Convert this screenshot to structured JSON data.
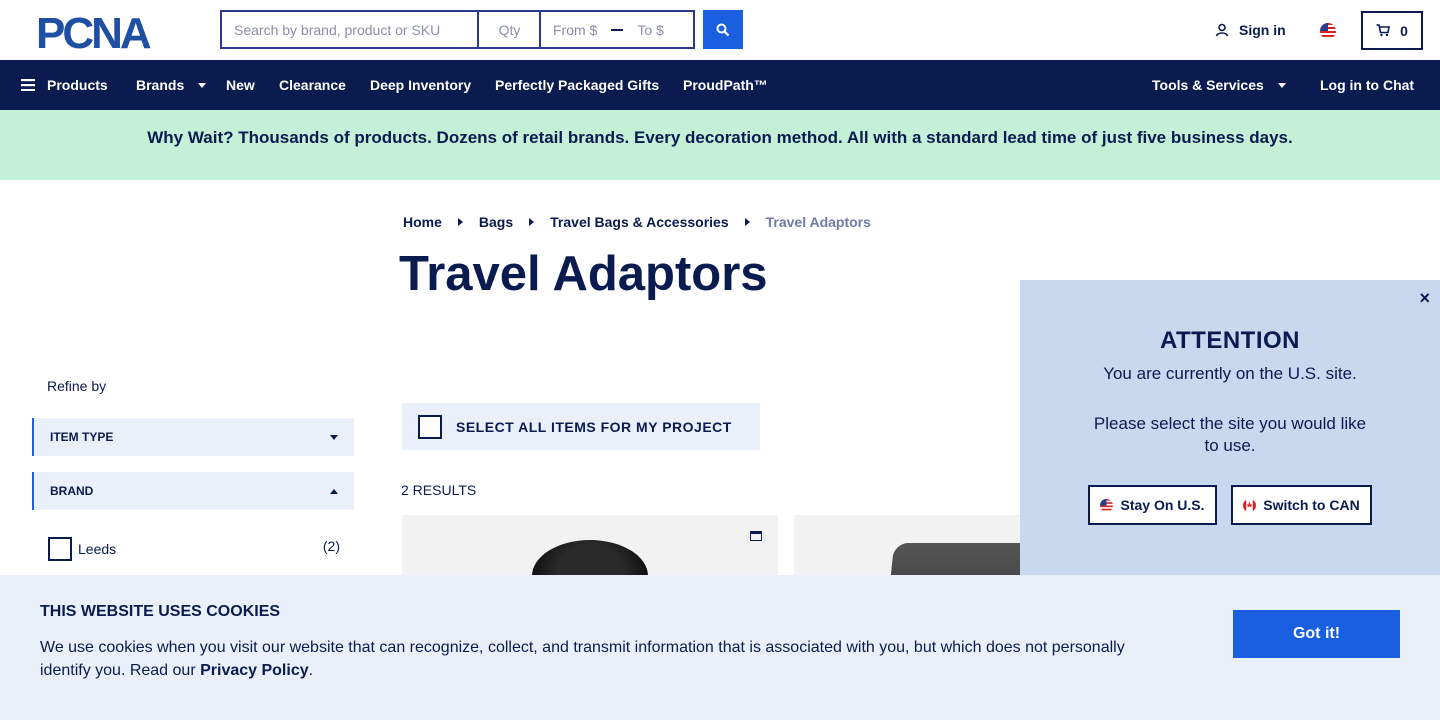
{
  "header": {
    "logo_text": "PCNA",
    "search_placeholder": "Search by brand, product or SKU",
    "qty_placeholder": "Qty",
    "price_from_placeholder": "From $",
    "price_to_placeholder": "To $",
    "signin_label": "Sign in",
    "cart_count": "0",
    "search_icon": "search-icon",
    "user_icon": "user-icon",
    "cart_icon": "cart-icon",
    "flag_icon": "us-flag-icon"
  },
  "nav": {
    "products": "Products",
    "brands": "Brands",
    "new": "New",
    "clearance": "Clearance",
    "deep_inventory": "Deep Inventory",
    "gifts": "Perfectly Packaged Gifts",
    "proudpath": "ProudPath™",
    "tools": "Tools & Services",
    "chat": "Log in to Chat"
  },
  "promo": {
    "text": "Why Wait? Thousands of products. Dozens of retail brands. Every decoration method. All with a standard lead time of just five business days."
  },
  "breadcrumb": {
    "items": [
      "Home",
      "Bags",
      "Travel Bags & Accessories"
    ],
    "current": "Travel Adaptors"
  },
  "page_title": "Travel Adaptors",
  "sidebar": {
    "refine_label": "Refine by",
    "facets": [
      {
        "label": "ITEM TYPE",
        "expanded": false
      },
      {
        "label": "BRAND",
        "expanded": true,
        "options": [
          {
            "label": "Leeds",
            "count": "(2)"
          }
        ]
      }
    ]
  },
  "results": {
    "select_all_label": "SELECT ALL ITEMS FOR MY PROJECT",
    "count_label": "2 RESULTS"
  },
  "attention_modal": {
    "close": "×",
    "title": "ATTENTION",
    "message1": "You are currently on the U.S. site.",
    "message2": "Please select the site you would like to use.",
    "stay_label": "Stay On U.S.",
    "switch_label": "Switch to CAN"
  },
  "cookie_banner": {
    "title": "THIS WEBSITE USES COOKIES",
    "text": "We use cookies when you visit our website that can recognize, collect, and transmit information that is associated with you, but which does not personally identify you. Read our ",
    "link": "Privacy Policy",
    "end": ".",
    "button": "Got it!"
  },
  "colors": {
    "navy": "#0a1b4f",
    "blue": "#1a5fe0",
    "promo_bg": "#c5f0d8",
    "modal_bg": "#c7d8ef",
    "banner_bg": "#eaf0fa"
  }
}
